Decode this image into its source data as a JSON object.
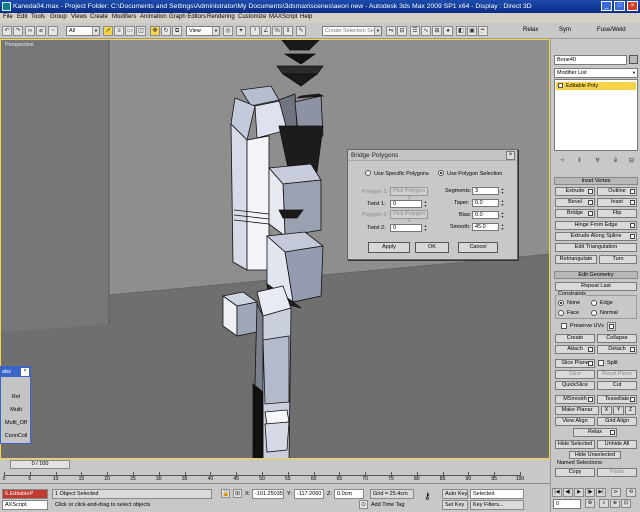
{
  "titlebar": {
    "text": "Kaneda04.max    - Project Folder: C:\\Documents and Settings\\Administrator\\My Documents\\3dsmax\\scenes\\aeon new     - Autodesk 3ds Max  2009 SP1  x64      - Display : Direct 3D"
  },
  "menu": [
    "File",
    "Edit",
    "Tools",
    "Group",
    "Views",
    "Create",
    "Modifiers",
    "Animation",
    "Graph Editors",
    "Rendering",
    "Customize",
    "MAXScript",
    "Help"
  ],
  "toolbar": {
    "selection_filter": "All",
    "ref_coord": "View",
    "named_selection_placeholder": "Create Selection Se",
    "relax_label": "Relax",
    "sym_label": "Sym",
    "fuse_label": "Fuse/Weld"
  },
  "viewport": {
    "label": "Perspective"
  },
  "dialog": {
    "title": "Bridge Polygons",
    "close": "×",
    "radio_specific": "Use Specific Polygons",
    "radio_selection": "Use Polygon Selection",
    "polygon1_label": "Polygon 1:",
    "polygon1_button": "Pick Polygon 1",
    "twist1_label": "Twist 1:",
    "twist1_value": "0",
    "polygon2_label": "Polygon 2:",
    "polygon2_button": "Pick Polygon 2",
    "twist2_label": "Twist 2:",
    "twist2_value": "0",
    "segments_label": "Segments:",
    "segments_value": "3",
    "taper_label": "Taper:",
    "taper_value": "0.0",
    "bias_label": "Bias:",
    "bias_value": "0.0",
    "smooth_label": "Smooth:",
    "smooth_value": "45.0",
    "apply": "Apply",
    "ok": "OK",
    "cancel": "Cancel"
  },
  "float_panel": {
    "title": "abs",
    "close": "×",
    "items": [
      "Rel",
      "Multi",
      "Multi_Off",
      "ConnColl"
    ]
  },
  "command_panel": {
    "object_name": "Bone40",
    "modifier_list": "Modifier List",
    "stack_item": "Editable Poly",
    "inset_vertex_header": "Inset Vertex",
    "buttons_row1": [
      "Extrude",
      "Outline"
    ],
    "buttons_row2": [
      "Bevel",
      "Inset"
    ],
    "buttons_row3": [
      "Bridge",
      "Flip"
    ],
    "hinge": "Hinge From Edge",
    "extrude_spline": "Extrude Along Spline",
    "edit_tri": "Edit Triangulation",
    "retri_row": [
      "Retriangulate",
      "Turn"
    ],
    "edit_geometry_header": "Edit Geometry",
    "repeat_last": "Repeat Last",
    "constraints_label": "Constraints",
    "c_none": "None",
    "c_edge": "Edge",
    "c_face": "Face",
    "c_normal": "Normal",
    "preserve_uvs": "Preserve UVs",
    "create_collapse": [
      "Create",
      "Collapse"
    ],
    "attach_detach": [
      "Attach",
      "Detach"
    ],
    "slice_plane": "Slice Plane",
    "split": "Split",
    "slice_reset": [
      "Slice",
      "Reset Plane"
    ],
    "quickslice_cut": [
      "QuickSlice",
      "Cut"
    ],
    "msmooth_tess": [
      "MSmooth",
      "Tessellate"
    ],
    "make_planar": "Make Planar",
    "xyz": [
      "X",
      "Y",
      "Z"
    ],
    "view_grid": [
      "View Align",
      "Grid Align"
    ],
    "relax": "Relax",
    "hide_row": [
      "Hide Selected",
      "Unhide All"
    ],
    "hide_unselected": "Hide Unselected",
    "named_selections": "Named Selections:",
    "copy_paste": [
      "Copy",
      "Paste"
    ]
  },
  "timeslider": {
    "frame": "0 / 100",
    "ticks": [
      "0",
      "5",
      "10",
      "15",
      "20",
      "25",
      "30",
      "35",
      "40",
      "45",
      "50",
      "55",
      "60",
      "65",
      "70",
      "75",
      "80",
      "85",
      "90",
      "95",
      "100"
    ]
  },
  "statusbar": {
    "script_box": "6.EditableP",
    "script_listener": "AXScript.",
    "status": "1 Object Selected",
    "prompt": "Click or click-and-drag to select objects",
    "x_label": "X:",
    "x_value": "-101.25035",
    "y_label": "Y:",
    "y_value": "-117.2060",
    "z_label": "Z:",
    "z_value": "0.0cm",
    "grid": "Grid = 25.4cm",
    "add_time_tag": "Add Time Tag",
    "auto_key": "Auto Key",
    "set_key": "Set Key",
    "selected": "Selected",
    "key_filters": "Key Filters...",
    "frame_value": "0"
  }
}
